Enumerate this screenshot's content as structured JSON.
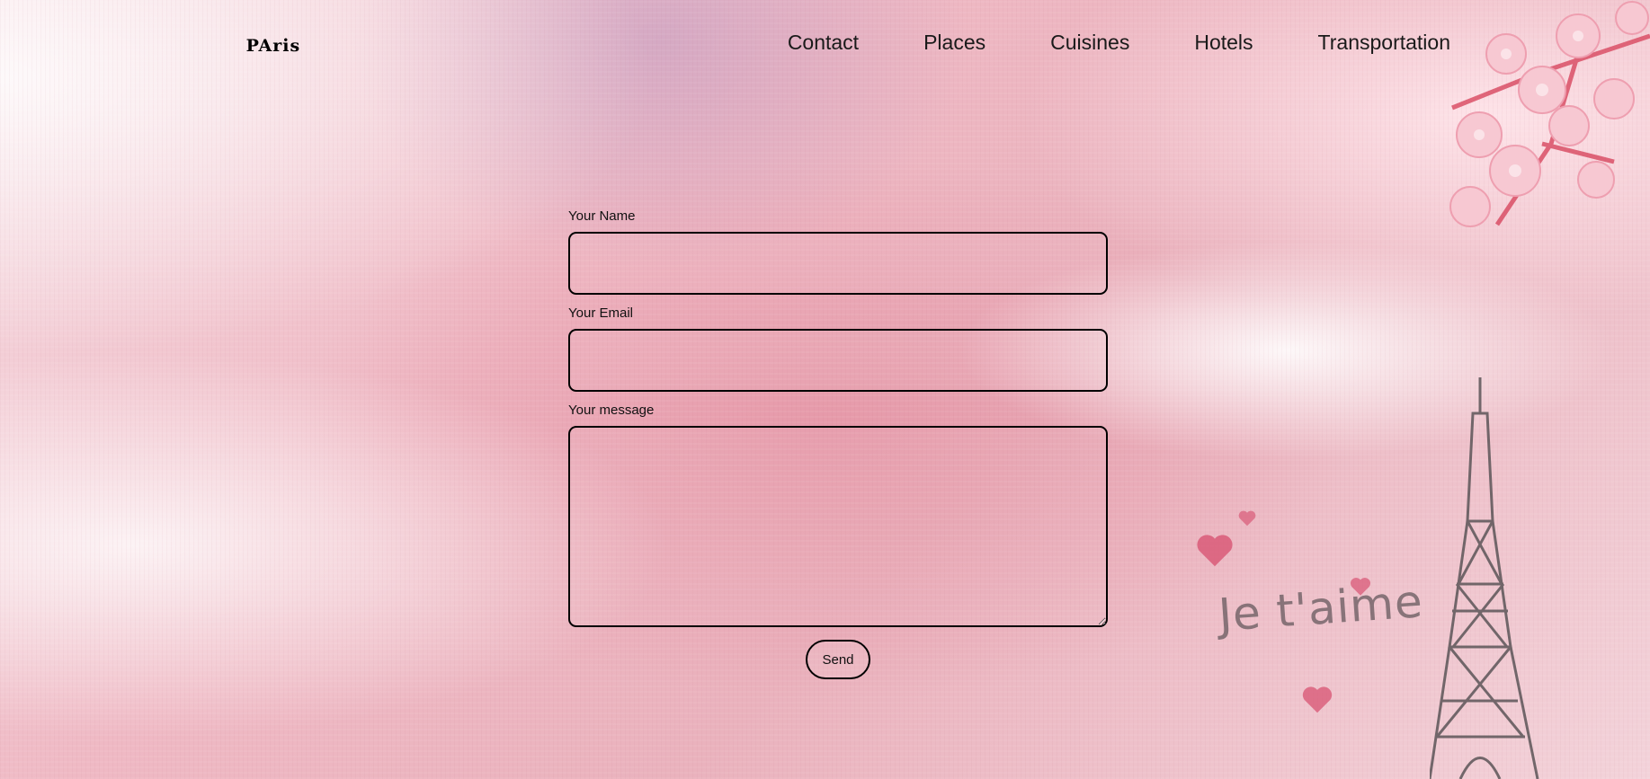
{
  "logo": {
    "text": "PAris"
  },
  "nav": {
    "items": [
      "Contact",
      "Places",
      "Cuisines",
      "Hotels",
      "Transportation"
    ]
  },
  "form": {
    "name_label": "Your Name",
    "name_value": "",
    "email_label": "Your Email",
    "email_value": "",
    "message_label": "Your message",
    "message_value": "",
    "send_label": "Send"
  },
  "decoration": {
    "handwriting": "Je t'aime"
  },
  "colors": {
    "background": "#efb9c4",
    "border": "#000000",
    "text": "#111111"
  }
}
